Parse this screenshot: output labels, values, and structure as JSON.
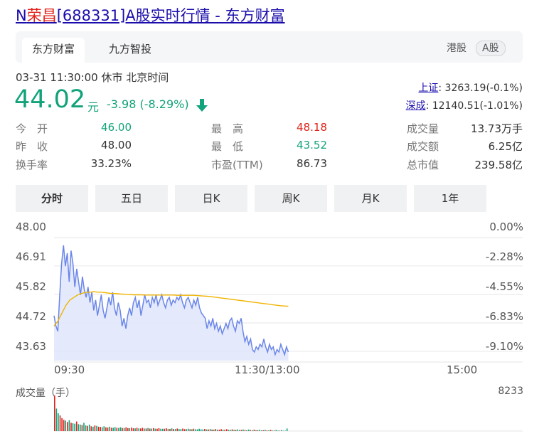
{
  "title": {
    "prefix": "N",
    "highlight": "荣昌",
    "suffix": "[688331]A股实时行情 - 东方财富"
  },
  "tabs": [
    {
      "label": "东方财富",
      "active": true
    },
    {
      "label": "九方智投",
      "active": false
    }
  ],
  "markets": {
    "hk": "港股",
    "a": "A股"
  },
  "timestamp": "03-31 11:30:00  休市  北京时间",
  "quote": {
    "price": "44.02",
    "unit": "元",
    "change": "-3.98 (-8.29%)",
    "direction": "down"
  },
  "indices": [
    {
      "name": "上证",
      "value": ": 3263.19(-0.1%)"
    },
    {
      "name": "深成",
      "value": ": 12140.51(-1.01%)"
    }
  ],
  "stats": {
    "open_label": "今　开",
    "open": "46.00",
    "prev_label": "昨　收",
    "prev": "48.00",
    "turnover_label": "换手率",
    "turnover": "33.23%",
    "high_label": "最　高",
    "high": "48.18",
    "low_label": "最　低",
    "low": "43.52",
    "pe_label": "市盈(TTM)",
    "pe": "86.73",
    "volume_label": "成交量",
    "volume": "13.73万手",
    "amount_label": "成交额",
    "amount": "6.25亿",
    "mcap_label": "总市值",
    "mcap": "239.58亿"
  },
  "periods": [
    {
      "label": "分时",
      "active": true
    },
    {
      "label": "五日",
      "active": false
    },
    {
      "label": "日K",
      "active": false
    },
    {
      "label": "周K",
      "active": false
    },
    {
      "label": "月K",
      "active": false
    },
    {
      "label": "1年",
      "active": false
    }
  ],
  "colors": {
    "price_line": "#6b86e8",
    "avg_line": "#f0b400",
    "area_fill": "#dfe6fb",
    "up": "#e0211a",
    "down": "#11a37a"
  },
  "chart_data": {
    "type": "line",
    "title": "",
    "y_ticks": [
      "48.00",
      "46.91",
      "45.82",
      "44.72",
      "43.63"
    ],
    "y_right_ticks": [
      "0.00%",
      "-2.28%",
      "-4.55%",
      "-6.83%",
      "-9.10%"
    ],
    "ylim": [
      43.27,
      48.0
    ],
    "x_ticks": [
      "09:30",
      "11:30/13:00",
      "15:00"
    ],
    "session_minutes": 240,
    "volume_label": "成交量（手）",
    "volume_max": "8233",
    "series": [
      {
        "name": "",
        "values": [
          45.0,
          44.6,
          44.4,
          45.8,
          47.0,
          47.7,
          46.9,
          47.4,
          46.3,
          47.5,
          47.0,
          46.1,
          46.8,
          46.3,
          45.8,
          46.5,
          46.0,
          45.7,
          46.1,
          45.5,
          45.9,
          45.2,
          45.6,
          45.0,
          45.4,
          45.8,
          45.2,
          44.9,
          45.3,
          45.7,
          45.4,
          45.9,
          45.3,
          45.0,
          45.5,
          45.2,
          44.6,
          44.9,
          44.5,
          45.0,
          45.3,
          45.0,
          45.5,
          45.7,
          45.3,
          45.6,
          45.0,
          45.4,
          45.8,
          45.5,
          45.6,
          45.3,
          45.7,
          45.5,
          45.8,
          45.4,
          45.6,
          45.8,
          45.5,
          45.3,
          45.6,
          45.7,
          45.4,
          45.6,
          45.5,
          45.7,
          45.6,
          45.8,
          45.5,
          45.3,
          45.6,
          45.7,
          45.5,
          45.3,
          45.6,
          45.4,
          45.7,
          45.3,
          45.1,
          45.0,
          44.9,
          44.5,
          44.8,
          44.6,
          44.9,
          44.5,
          44.7,
          44.4,
          44.6,
          44.3,
          44.5,
          44.7,
          44.5,
          44.8,
          44.9,
          44.6,
          44.4,
          44.8,
          44.7,
          44.9,
          44.4,
          44.0,
          44.2,
          43.9,
          44.1,
          43.7,
          43.6,
          43.8,
          43.7,
          43.9,
          43.8,
          44.1,
          43.8,
          43.6,
          43.9,
          43.7,
          43.8,
          43.5,
          43.7,
          43.6,
          43.9,
          43.7,
          43.5,
          43.8,
          43.6
        ]
      },
      {
        "name": "",
        "values": [
          44.6,
          44.8,
          45.1,
          45.4,
          45.6,
          45.7,
          45.8,
          45.85,
          45.9,
          45.9,
          45.92,
          45.9,
          45.9,
          45.88,
          45.86,
          45.85,
          45.84,
          45.83,
          45.82,
          45.81,
          45.8,
          45.8,
          45.8,
          45.79,
          45.79,
          45.79,
          45.79,
          45.79,
          45.79,
          45.79,
          45.79,
          45.78,
          45.78,
          45.78,
          45.78,
          45.78,
          45.77,
          45.76,
          45.75,
          45.74,
          45.72,
          45.7,
          45.68,
          45.66,
          45.64,
          45.62,
          45.6,
          45.58,
          45.56,
          45.54,
          45.52,
          45.5,
          45.48,
          45.46,
          45.44,
          45.42,
          45.4,
          45.38,
          45.37,
          45.36
        ]
      }
    ],
    "volume": [
      8233,
      5200,
      4100,
      3600,
      3000,
      2600,
      2400,
      2100,
      2500,
      1900,
      1800,
      1700,
      2200,
      1600,
      1500,
      1400,
      1900,
      1300,
      1200,
      1500,
      1100,
      1000,
      1300,
      1200,
      1000,
      950,
      900,
      1100,
      850,
      800,
      1000,
      780,
      760,
      900,
      740,
      720,
      880,
      700,
      690,
      850,
      680,
      660,
      800,
      640,
      630,
      760,
      620,
      610,
      740,
      600,
      590,
      700,
      580,
      570,
      680,
      560,
      550,
      660,
      540,
      530,
      520,
      640,
      510,
      500,
      620,
      490,
      480,
      600,
      470,
      460,
      580,
      450,
      440,
      560,
      430,
      420,
      540,
      410,
      400,
      520,
      390,
      380,
      500,
      370,
      360,
      480,
      350,
      340,
      460,
      330,
      320,
      440,
      310,
      300,
      420,
      290,
      280,
      400,
      270,
      260,
      380,
      250,
      240,
      360,
      230,
      220,
      340,
      210,
      200,
      320,
      190,
      180,
      300,
      170,
      160,
      280,
      150,
      140,
      260,
      130,
      120,
      240,
      110,
      100,
      220,
      90,
      80,
      600
    ]
  }
}
